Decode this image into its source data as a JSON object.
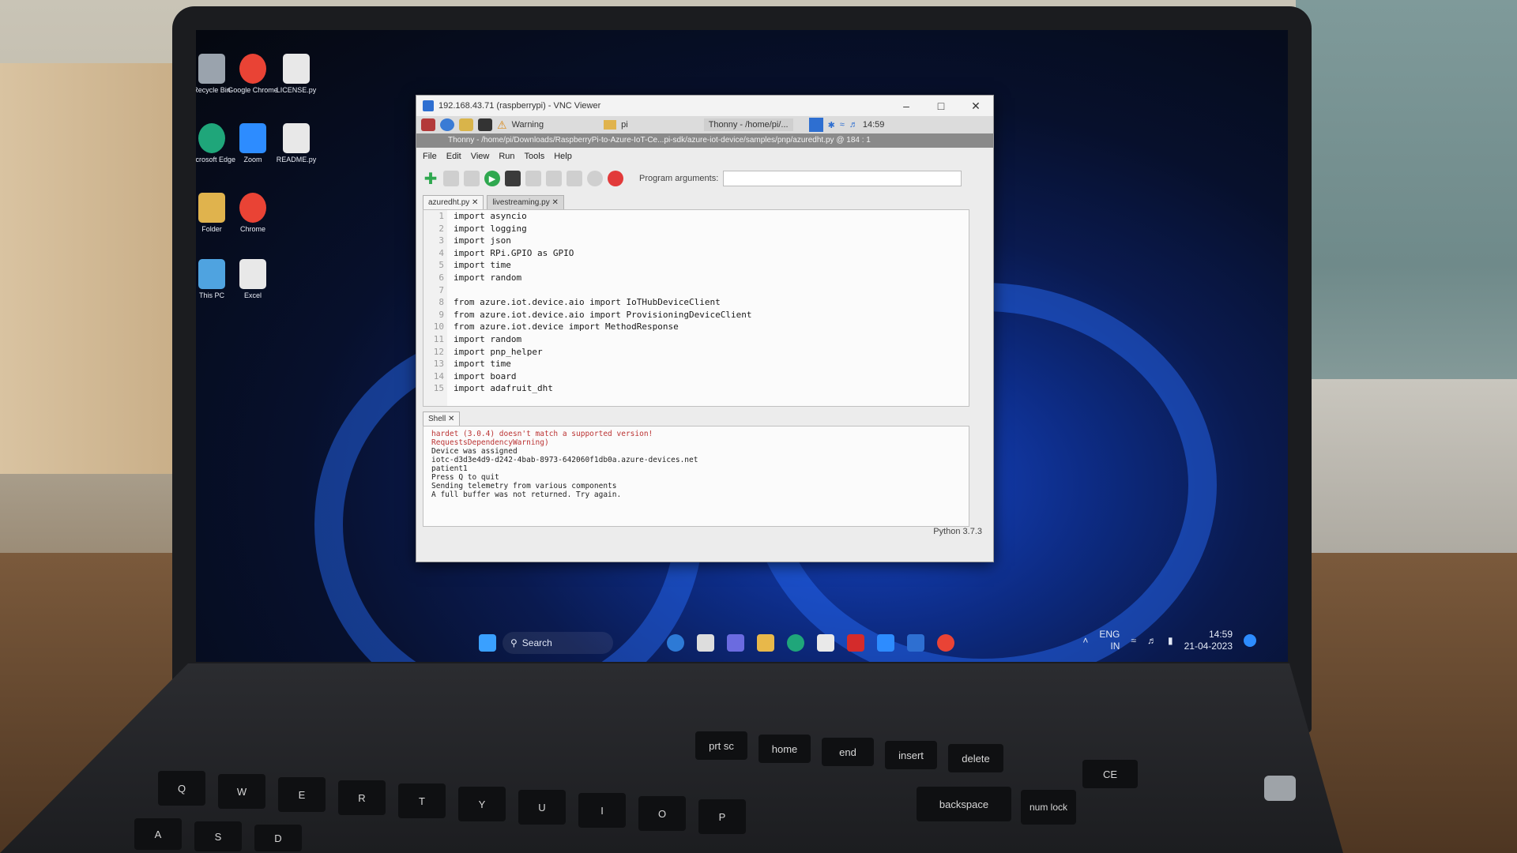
{
  "vnc": {
    "title": "192.168.43.71 (raspberrypi) - VNC Viewer",
    "warning_label": "Warning",
    "folder_label": "pi",
    "thonny_task_label": "Thonny - /home/pi/...",
    "pi_clock": "14:59",
    "thonny_title": "Thonny - /home/pi/Downloads/RaspberryPi-to-Azure-IoT-Ce...pi-sdk/azure-iot-device/samples/pnp/azuredht.py @ 184 : 1"
  },
  "thonny": {
    "menu": [
      "File",
      "Edit",
      "View",
      "Run",
      "Tools",
      "Help"
    ],
    "program_args_label": "Program arguments:",
    "tabs": [
      "azuredht.py",
      "livestreaming.py"
    ],
    "code_lines": [
      "import asyncio",
      "import logging",
      "import json",
      "import RPi.GPIO as GPIO",
      "import time",
      "import random",
      "",
      "from azure.iot.device.aio import IoTHubDeviceClient",
      "from azure.iot.device.aio import ProvisioningDeviceClient",
      "from azure.iot.device import MethodResponse",
      "import random",
      "import pnp_helper",
      "import time",
      "import board",
      "import adafruit_dht"
    ],
    "line_numbers": [
      "1",
      "2",
      "3",
      "4",
      "5",
      "6",
      "7",
      "8",
      "9",
      "10",
      "11",
      "12",
      "13",
      "14",
      "15"
    ],
    "shell_tab": "Shell",
    "shell_lines": [
      {
        "text": "hardet (3.0.4) doesn't match a supported version!",
        "kind": "warn"
      },
      {
        "text": "  RequestsDependencyWarning)",
        "kind": "warn"
      },
      {
        "text": "Device was assigned",
        "kind": "out"
      },
      {
        "text": "iotc-d3d3e4d9-d242-4bab-8973-642060f1db0a.azure-devices.net",
        "kind": "out"
      },
      {
        "text": "patient1",
        "kind": "out"
      },
      {
        "text": "Press Q to quit",
        "kind": "out"
      },
      {
        "text": "Sending telemetry from various components",
        "kind": "out"
      },
      {
        "text": "A full buffer was not returned. Try again.",
        "kind": "out"
      }
    ],
    "python_version": "Python 3.7.3"
  },
  "desktop_icons": [
    {
      "label": "Recycle Bin",
      "color": "#9aa3ad"
    },
    {
      "label": "Google Chrome",
      "color": "#e94335"
    },
    {
      "label": "LICENSE.py",
      "color": "#e8e8e8"
    },
    {
      "label": "Microsoft Edge",
      "color": "#1fa67a"
    },
    {
      "label": "Zoom",
      "color": "#2d8cff"
    },
    {
      "label": "README.py",
      "color": "#e8e8e8"
    },
    {
      "label": "Folder",
      "color": "#e0b34d"
    },
    {
      "label": "Chrome",
      "color": "#e94335"
    },
    {
      "label": "This PC",
      "color": "#4fa3e0"
    },
    {
      "label": "Excel",
      "color": "#e8e8e8"
    }
  ],
  "taskbar": {
    "search_label": "Search",
    "lang": "ENG",
    "region": "IN",
    "time": "14:59",
    "date": "21-04-2023"
  },
  "keyboard": {
    "row1": [
      "Q",
      "W",
      "E",
      "R",
      "T",
      "Y",
      "U",
      "I",
      "O",
      "P"
    ],
    "row2": [
      "A",
      "S",
      "D"
    ],
    "backspace": "backspace",
    "num_lock": "num lock",
    "prt_sc": "prt sc",
    "home": "home",
    "end": "end",
    "insert": "insert",
    "delete": "delete",
    "ce": "CE"
  }
}
